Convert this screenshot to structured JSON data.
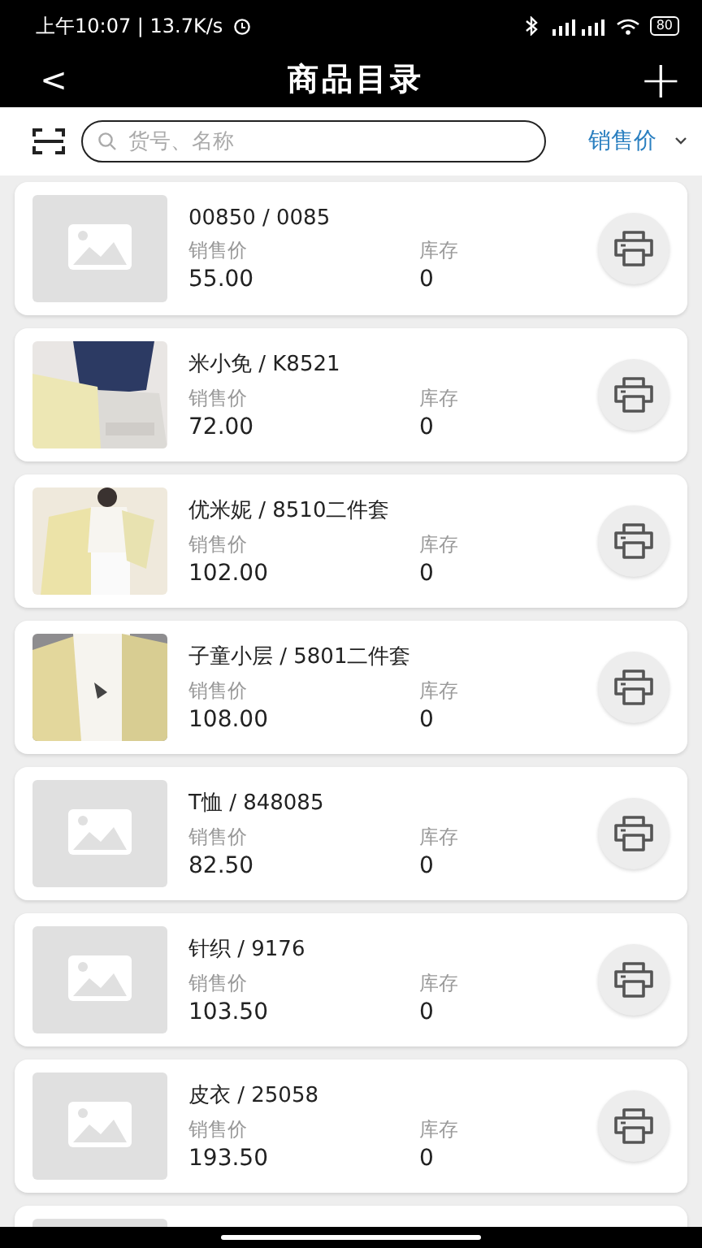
{
  "status_bar": {
    "time_speed": "上午10:07 | 13.7K/s",
    "battery": "80"
  },
  "header": {
    "back": "<",
    "title": "商品目录",
    "add": "+"
  },
  "search": {
    "placeholder": "货号、名称",
    "sort_label": "销售价"
  },
  "products": [
    {
      "kind": "placeholder",
      "name": "00850 / 0085",
      "price_label": "销售价",
      "price": "55.00",
      "stock_label": "库存",
      "stock": "0"
    },
    {
      "name": "米小免 / K8521",
      "price_label": "销售价",
      "price": "72.00",
      "stock_label": "库存",
      "stock": "0"
    },
    {
      "name": "优米妮 / 8510二件套",
      "price_label": "销售价",
      "price": "102.00",
      "stock_label": "库存",
      "stock": "0"
    },
    {
      "name": "子童小层 / 5801二件套",
      "price_label": "销售价",
      "price": "108.00",
      "stock_label": "库存",
      "stock": "0"
    },
    {
      "kind": "placeholder",
      "name": "T恤 / 848085",
      "price_label": "销售价",
      "price": "82.50",
      "stock_label": "库存",
      "stock": "0"
    },
    {
      "kind": "placeholder",
      "name": "针织 / 9176",
      "price_label": "销售价",
      "price": "103.50",
      "stock_label": "库存",
      "stock": "0"
    },
    {
      "kind": "placeholder",
      "name": "皮衣 / 25058",
      "price_label": "销售价",
      "price": "193.50",
      "stock_label": "库存",
      "stock": "0"
    },
    {
      "kind": "placeholder"
    }
  ]
}
